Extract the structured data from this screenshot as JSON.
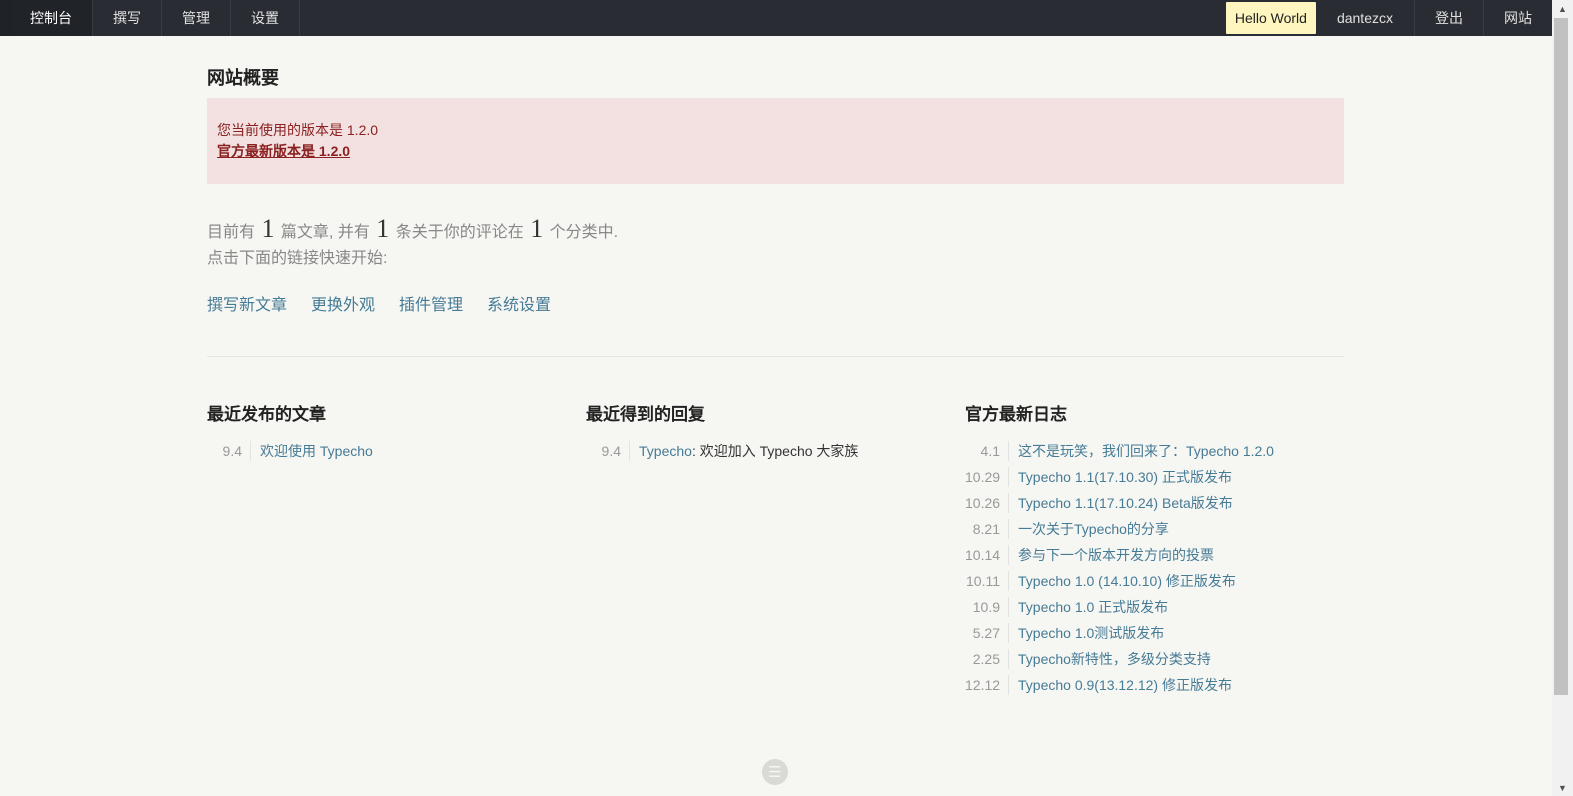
{
  "nav": {
    "left": [
      "控制台",
      "撰写",
      "管理",
      "设置"
    ],
    "right": {
      "hello": "Hello World",
      "user": "dantezcx",
      "logout": "登出",
      "site": "网站"
    }
  },
  "page": {
    "title": "网站概要",
    "notice": {
      "current": "您当前使用的版本是 1.2.0",
      "latest": "官方最新版本是 1.2.0"
    },
    "summary": {
      "prefix": "目前有",
      "posts": "1",
      "mid1": "篇文章, 并有",
      "comments": "1",
      "mid2": "条关于你的评论在",
      "categories": "1",
      "suffix": "个分类中."
    },
    "hint": "点击下面的链接快速开始:",
    "quicklinks": [
      "撰写新文章",
      "更换外观",
      "插件管理",
      "系统设置"
    ]
  },
  "columns": {
    "posts": {
      "title": "最近发布的文章",
      "items": [
        {
          "date": "9.4",
          "text": "欢迎使用 Typecho"
        }
      ]
    },
    "replies": {
      "title": "最近得到的回复",
      "items": [
        {
          "date": "9.4",
          "author": "Typecho",
          "sep": ": ",
          "text": "欢迎加入 Typecho 大家族"
        }
      ]
    },
    "news": {
      "title": "官方最新日志",
      "items": [
        {
          "date": "4.1",
          "text": "这不是玩笑，我们回来了：Typecho 1.2.0"
        },
        {
          "date": "10.29",
          "text": "Typecho 1.1(17.10.30) 正式版发布"
        },
        {
          "date": "10.26",
          "text": "Typecho 1.1(17.10.24) Beta版发布"
        },
        {
          "date": "8.21",
          "text": "一次关于Typecho的分享"
        },
        {
          "date": "10.14",
          "text": "参与下一个版本开发方向的投票"
        },
        {
          "date": "10.11",
          "text": "Typecho 1.0 (14.10.10) 修正版发布"
        },
        {
          "date": "10.9",
          "text": "Typecho 1.0 正式版发布"
        },
        {
          "date": "5.27",
          "text": "Typecho 1.0测试版发布"
        },
        {
          "date": "2.25",
          "text": "Typecho新特性，多级分类支持"
        },
        {
          "date": "12.12",
          "text": "Typecho 0.9(13.12.12) 修正版发布"
        }
      ]
    }
  },
  "icons": {
    "footer": "menu-lines-icon",
    "scroll_up": "arrow-up-icon",
    "scroll_down": "arrow-down-icon"
  }
}
